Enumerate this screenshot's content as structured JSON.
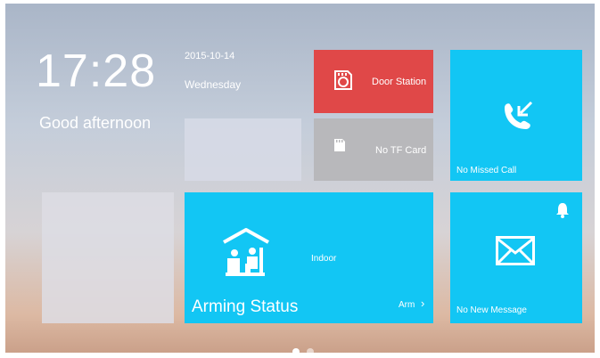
{
  "clock": {
    "time": "17:28",
    "greeting": "Good afternoon",
    "date": "2015-10-14",
    "weekday": "Wednesday"
  },
  "tiles": {
    "door_station": {
      "label": "Door Station",
      "icon": "sd-card-icon",
      "color": "#e04848"
    },
    "tf_card": {
      "label": "No TF Card",
      "icon": "sd-card-icon",
      "color": "#b8b8bb"
    },
    "missed_call": {
      "label": "No Missed Call",
      "icon": "missed-call-icon",
      "color": "#12c6f4"
    },
    "arming": {
      "title": "Arming Status",
      "mode": "Indoor",
      "action": "Arm",
      "icon": "indoor-house-icon",
      "color": "#12c6f4"
    },
    "message": {
      "label": "No New Message",
      "icon": "envelope-icon",
      "bell_icon": "bell-icon",
      "color": "#12c6f4"
    }
  },
  "pager": {
    "pages": 2,
    "active_page": 1,
    "chevron": "›"
  }
}
